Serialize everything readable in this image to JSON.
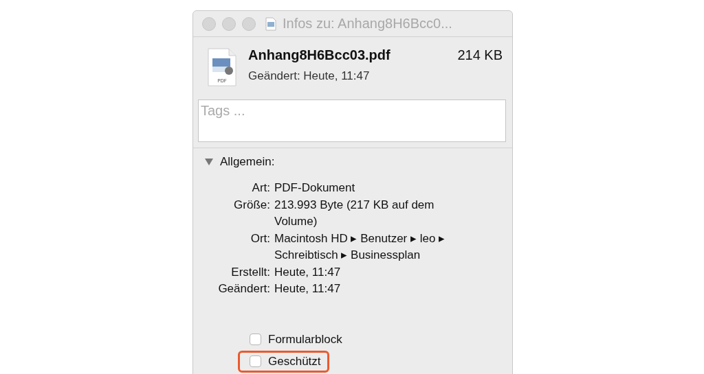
{
  "window": {
    "title": "Infos zu: Anhang8H6Bcc0..."
  },
  "file": {
    "name": "Anhang8H6Bcc03.pdf",
    "size": "214 KB",
    "modified": "Geändert: Heute, 11:47",
    "icon_label": "PDF"
  },
  "tags": {
    "placeholder": "Tags ..."
  },
  "section": {
    "title": "Allgemein:",
    "expanded": true,
    "rows": [
      {
        "label": "Art:",
        "value": "PDF-Dokument"
      },
      {
        "label": "Größe:",
        "value": "213.993 Byte (217 KB auf dem Volume)"
      },
      {
        "label": "Ort:",
        "value": "Macintosh HD ▸ Benutzer ▸ leo ▸ Schreibtisch ▸ Businessplan"
      },
      {
        "label": "Erstellt:",
        "value": "Heute, 11:47"
      },
      {
        "label": "Geändert:",
        "value": "Heute, 11:47"
      }
    ],
    "checkboxes": [
      {
        "label": "Formularblock",
        "checked": false,
        "highlighted": false
      },
      {
        "label": "Geschützt",
        "checked": false,
        "highlighted": true
      }
    ]
  }
}
